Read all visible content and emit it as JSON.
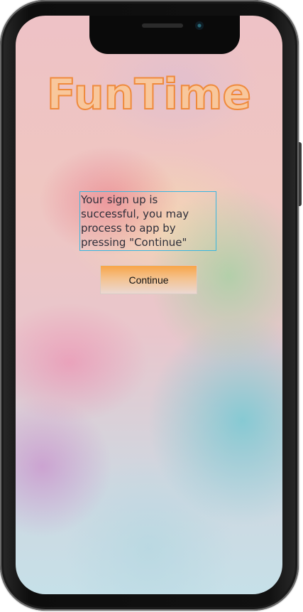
{
  "app": {
    "title": "FunTime"
  },
  "message": {
    "text": "Your sign up is successful, you may process to app by pressing \"Continue\""
  },
  "actions": {
    "continue_label": "Continue"
  },
  "colors": {
    "title_fill": "#f8c79c",
    "title_stroke": "#ef8a3c",
    "message_border": "#38b6e0",
    "button_gradient_top": "#f8a548",
    "button_gradient_bottom": "#ebd8d3"
  }
}
